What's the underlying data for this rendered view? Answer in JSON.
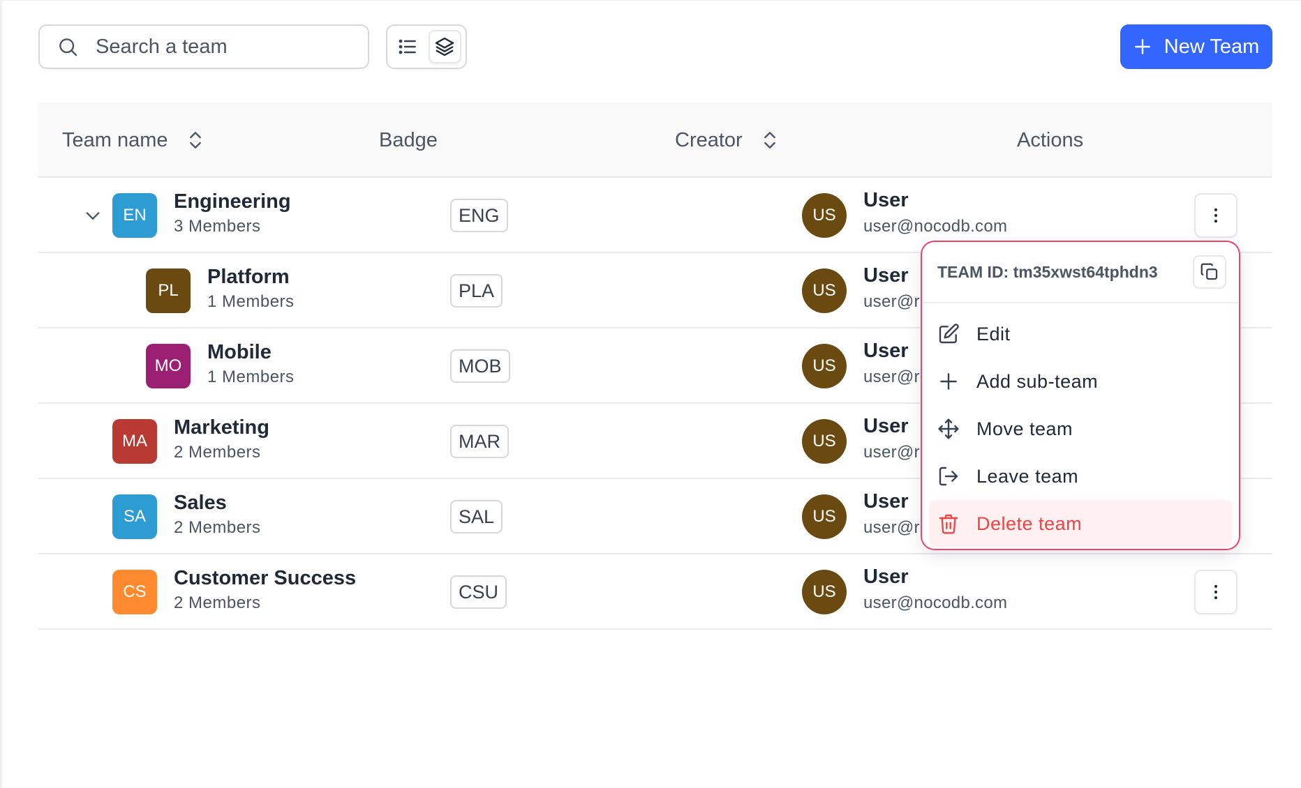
{
  "toolbar": {
    "search_placeholder": "Search a team",
    "new_team_label": "New Team"
  },
  "table": {
    "headers": {
      "team_name": "Team name",
      "badge": "Badge",
      "creator": "Creator",
      "actions": "Actions"
    },
    "rows": [
      {
        "initials": "EN",
        "name": "Engineering",
        "members": "3 Members",
        "badge": "ENG",
        "avatar_color": "#2d9cd3",
        "creator_initials": "US",
        "creator_name": "User",
        "creator_email": "user@nocodb.com"
      },
      {
        "initials": "PL",
        "name": "Platform",
        "members": "1 Members",
        "badge": "PLA",
        "avatar_color": "#6b4a11",
        "creator_initials": "US",
        "creator_name": "User",
        "creator_email": "user@r"
      },
      {
        "initials": "MO",
        "name": "Mobile",
        "members": "1 Members",
        "badge": "MOB",
        "avatar_color": "#9b1f73",
        "creator_initials": "US",
        "creator_name": "User",
        "creator_email": "user@r"
      },
      {
        "initials": "MA",
        "name": "Marketing",
        "members": "2 Members",
        "badge": "MAR",
        "avatar_color": "#b93a32",
        "creator_initials": "US",
        "creator_name": "User",
        "creator_email": "user@r"
      },
      {
        "initials": "SA",
        "name": "Sales",
        "members": "2 Members",
        "badge": "SAL",
        "avatar_color": "#2d9cd3",
        "creator_initials": "US",
        "creator_name": "User",
        "creator_email": "user@r"
      },
      {
        "initials": "CS",
        "name": "Customer Success",
        "members": "2 Members",
        "badge": "CSU",
        "avatar_color": "#ff8a30",
        "creator_initials": "US",
        "creator_name": "User",
        "creator_email": "user@nocodb.com"
      }
    ]
  },
  "menu": {
    "team_id_label": "TEAM ID: tm35xwst64tphdn3",
    "items": [
      {
        "label": "Edit",
        "icon": "edit-icon"
      },
      {
        "label": "Add sub-team",
        "icon": "plus-icon"
      },
      {
        "label": "Move team",
        "icon": "move-icon"
      },
      {
        "label": "Leave team",
        "icon": "leave-icon"
      },
      {
        "label": "Delete team",
        "icon": "trash-icon"
      }
    ]
  },
  "colors": {
    "primary": "#3366ff",
    "danger": "#ef4444",
    "creator_avatar": "#6b4a11",
    "menu_border": "#f0436b"
  }
}
